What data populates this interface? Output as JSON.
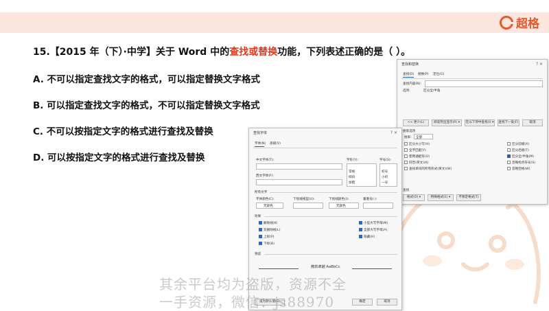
{
  "brand": {
    "name": "超格"
  },
  "question": {
    "prefix": "15.【2015 年（下）·中学】关于 Word 中的",
    "highlight": "查找或替换",
    "suffix": "功能，下列表述正确的是（ ）。"
  },
  "options": [
    "A. 不可以指定查找文字的格式，可以指定替换文字格式",
    "B. 可以指定查找文字的格式，不可以指定替换文字格式",
    "C. 不可以按指定文字的格式进行查找及替换",
    "D. 可以按指定文字的格式进行查找及替换"
  ],
  "find_dialog": {
    "title": "查找和替换",
    "controls": "?   ×",
    "tabs": [
      "查找(D)",
      "替换(P)",
      "定位(G)"
    ],
    "find_label": "查找内容(N):",
    "options_label": "选项:",
    "options_value": "区分全/半角",
    "buttons": [
      "<< 更少(L)",
      "阅读突出显示(R) ▾",
      "在以下项中查找(I) ▾",
      "查找下一处(F)",
      "取消"
    ],
    "search_options_title": "搜索选项",
    "search_label": "搜索:",
    "search_value": "全部",
    "checks_left": [
      "区分大小写(H)",
      "全字匹配(Y)",
      "使用通配符(U)",
      "同音(英文)(K)",
      "查找单词的所有形式(英文)(W)"
    ],
    "checks_right": [
      "区分前缀(X)",
      "区分后缀(T)",
      "区分全/半角(M)",
      "忽略标点符号(S)",
      "忽略空格(W)"
    ],
    "find_section": "查找",
    "format_buttons": [
      "格式(O) ▾",
      "特殊格式(E) ▾",
      "不限定格式(T)"
    ]
  },
  "font_dialog": {
    "title": "查找字体",
    "controls": "?   ×",
    "tabs": [
      "字体(N)",
      "高级(V)"
    ],
    "cn_font_label": "中文字体(T):",
    "west_font_label": "西文字体(F):",
    "style_label": "字形(Y):",
    "styles": [
      "常规",
      "倾斜",
      "加粗"
    ],
    "size_label": "字号(S):",
    "sizes": [
      "初号",
      "小初",
      "一号"
    ],
    "all_text_title": "所有文字",
    "color_label": "字体颜色(C):",
    "color_value": "无颜色",
    "underline_label": "下划线线型(U):",
    "underline_color_label": "下划线颜色(I):",
    "underline_color_value": "无颜色",
    "emphasis_label": "着重号(·):",
    "effects_title": "效果",
    "effects_left": [
      "删除线(K)",
      "双删除线(L)",
      "上标(P)",
      "下标(B)"
    ],
    "effects_right": [
      "小型大写字母(M)",
      "全部大写字母(A)",
      "隐藏(H)"
    ],
    "preview_title": "预览",
    "preview_text": "微软卓越  AaBbCc",
    "buttons": [
      "设为默认值(D)",
      "确定",
      "取消"
    ]
  },
  "watermark": {
    "line1": "其余平台均为盗版，资源不全",
    "line2": "一手资源，微信：js88970"
  },
  "colors": {
    "accent": "#e8572a",
    "highlight": "#e03a1e",
    "banner": "#fbe7df"
  }
}
